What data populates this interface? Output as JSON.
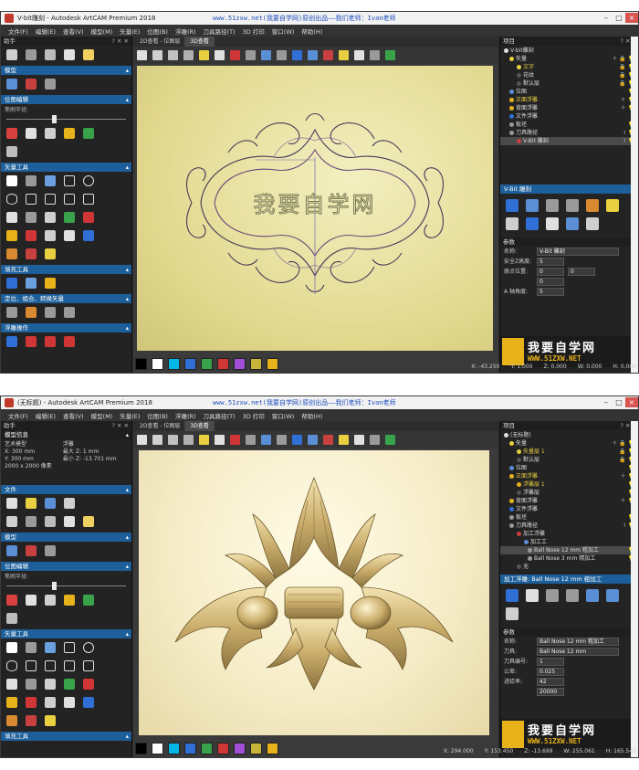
{
  "colors": {
    "accent": "#1d5f9a",
    "panel": "#232323",
    "canvas1": "#e2d98f",
    "canvas2": "#f6edc8",
    "ornament_gold": "#b89a4e",
    "logo_gold": "#e8b21a"
  },
  "watermark": "www.51zxw.net(我要自学网)原创出品——我们老师：Ivan老师",
  "palette": [
    "#000000",
    "#ffffff",
    "#00b7e8",
    "#2f6fd6",
    "#38a34a",
    "#d13636",
    "#a24ed6",
    "#c9b43a",
    "#e8b21a"
  ],
  "logo": {
    "name": "我要自学网",
    "site": "WWW.51ZXW.NET"
  },
  "menu": [
    "文件(F)",
    "编辑(E)",
    "查看(V)",
    "模型(M)",
    "矢量(E)",
    "位图(B)",
    "浮雕(R)",
    "刀具路径(T)",
    "3D 打印",
    "窗口(W)",
    "帮助(H)"
  ],
  "view_tabs": [
    "2D查看 - 位图层",
    "3D查看"
  ],
  "shot1": {
    "title": "V-bit雕刻 - Autodesk ArtCAM Premium 2018",
    "left": {
      "header": "助手",
      "sections": [
        "模型",
        "位图编辑",
        "矢量工具",
        "填充工具",
        "定位、组合、转换矢量",
        "浮雕操作"
      ],
      "brush_label": "笔刷半径:"
    },
    "ornament_text": "我要自学网",
    "right": {
      "header": "项目",
      "tree": [
        {
          "label": "V-bit雕刻"
        },
        {
          "label": "矢量"
        },
        {
          "label": "文字"
        },
        {
          "label": "花纹"
        },
        {
          "label": "默认层"
        },
        {
          "label": "位图"
        },
        {
          "label": "正面浮雕"
        },
        {
          "label": "背面浮雕"
        },
        {
          "label": "文件浮雕"
        },
        {
          "label": "板坯"
        },
        {
          "label": "刀具路径"
        },
        {
          "label": "V-Bit 雕刻"
        }
      ],
      "tool_header": "V-Bit 雕刻",
      "params_header": "参数",
      "params": [
        {
          "label": "名称:",
          "value": "V-Bit 雕刻"
        },
        {
          "label": "安全Z高度:",
          "value": "5"
        },
        {
          "label": "原点位置:",
          "value": "0",
          "value2": "0"
        },
        {
          "label": "",
          "value": "0"
        },
        {
          "label": "A 轴角度:",
          "value": "5"
        }
      ]
    },
    "coords": {
      "x": "X: -43.250",
      "y": "Y: 1.000",
      "z": "Z: 0.000",
      "w": "W: 0.000",
      "h": "H: 0.000"
    }
  },
  "shot2": {
    "title": "(无标题) - Autodesk ArtCAM Premium 2018",
    "left": {
      "header": "助手",
      "model_info_title": "模型信息",
      "model_info": {
        "col1": [
          "艺术模型",
          "X: 300 mm",
          "Y: 300 mm",
          "2000 x 2000 像素"
        ],
        "col2": [
          "浮雕",
          "最大 Z: 1 mm",
          "最小 Z: -13.701 mm",
          ""
        ]
      },
      "sections": [
        "文件",
        "模型",
        "位图编辑",
        "矢量工具",
        "填充工具"
      ],
      "brush_label": "笔刷半径:"
    },
    "right": {
      "header": "项目",
      "tree": [
        {
          "label": "(无标题)"
        },
        {
          "label": "矢量"
        },
        {
          "label": "矢量层 1"
        },
        {
          "label": "默认层"
        },
        {
          "label": "位图"
        },
        {
          "label": "正面浮雕"
        },
        {
          "label": "浮雕层 1"
        },
        {
          "label": "浮雕层"
        },
        {
          "label": "背面浮雕"
        },
        {
          "label": "文件浮雕"
        },
        {
          "label": "板坯"
        },
        {
          "label": "刀具路径"
        },
        {
          "label": "加工浮雕"
        },
        {
          "label": "加工工"
        },
        {
          "label": "Ball Nose 12 mm 粗加工"
        },
        {
          "label": "Ball Nose 3 mm 精加工"
        },
        {
          "label": "无"
        }
      ],
      "tool_header": "加工浮雕: Ball Nose 12 mm 粗加工",
      "params_header": "参数",
      "params": [
        {
          "label": "名称:",
          "value": "Ball Nose 12 mm 粗加工"
        },
        {
          "label": "刀具:",
          "value": "Ball Nose 12 mm"
        },
        {
          "label": "刀具编号:",
          "value": "1"
        },
        {
          "label": "公差:",
          "value": "0.025"
        },
        {
          "label": "进给率:",
          "value": "42"
        },
        {
          "label": "",
          "value": "20000"
        }
      ]
    },
    "coords": {
      "x": "X: 294.000",
      "y": "Y: 153.450",
      "z": "Z: -13.699",
      "w": "W: 255.061",
      "h": "H: 165.543"
    }
  }
}
